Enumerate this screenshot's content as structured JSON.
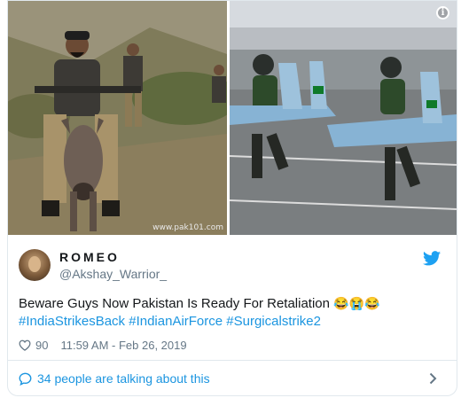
{
  "media": {
    "watermark": "www.pak101.com",
    "info_icon": "i"
  },
  "user": {
    "display_name": "ROMEO",
    "handle": "@Akshay_Warrior_"
  },
  "tweet": {
    "text": "Beware Guys Now Pakistan Is Ready For Retaliation",
    "emojis": "😂😭😂",
    "hashtags": "#IndiaStrikesBack #IndianAirForce #Surgicalstrike2"
  },
  "meta": {
    "like_count": "90",
    "timestamp": "11:59 AM - Feb 26, 2019"
  },
  "footer": {
    "talking_label": "34 people are talking about this"
  },
  "colors": {
    "link": "#1b95e0",
    "muted": "#657786",
    "border": "#e1e8ed",
    "twitter_blue": "#1da1f2"
  },
  "icons": [
    "info-icon",
    "twitter-bird-icon",
    "heart-icon",
    "speech-bubble-icon",
    "chevron-right-icon"
  ]
}
